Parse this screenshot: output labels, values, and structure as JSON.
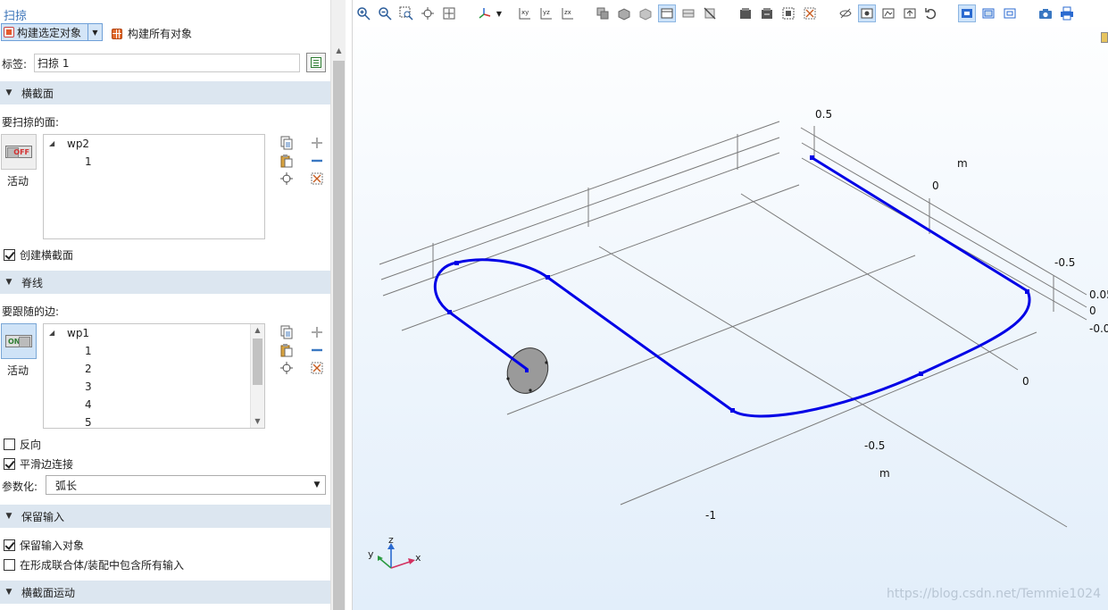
{
  "panel": {
    "title": "扫掠",
    "build_selected_label": "构建选定对象",
    "build_all_label": "构建所有对象",
    "label_field_label": "标签:",
    "label_field_value": "扫掠 1"
  },
  "cross_section": {
    "header": "横截面",
    "faces_label": "要扫掠的面:",
    "active_label": "活动",
    "toggle_state": "OFF",
    "list": [
      "wp2",
      "1"
    ],
    "create_checkbox_label": "创建横截面",
    "create_checked": true
  },
  "spine": {
    "header": "脊线",
    "edges_label": "要跟随的边:",
    "active_label": "活动",
    "toggle_state": "ON",
    "list": [
      "wp1",
      "1",
      "2",
      "3",
      "4",
      "5"
    ],
    "reverse_label": "反向",
    "reverse_checked": false,
    "smooth_label": "平滑边连接",
    "smooth_checked": true,
    "param_label": "参数化:",
    "param_value": "弧长"
  },
  "keep_input": {
    "header": "保留输入",
    "keep_objects_label": "保留输入对象",
    "keep_objects_checked": true,
    "include_all_label": "在形成联合体/装配中包含所有输入",
    "include_all_checked": false
  },
  "motion": {
    "header": "横截面运动"
  },
  "graphics": {
    "toolbar_icons": [
      "zoom-in-icon",
      "zoom-out-icon",
      "zoom-box-icon",
      "zoom-selected-icon",
      "zoom-extents-icon",
      "view-axis-icon",
      "view-dropdown-icon",
      "view-xy-icon",
      "view-yz-icon",
      "view-zx-icon",
      "scene-light-icon",
      "transparency-icon",
      "wireframe-icon",
      "render-mode-icon",
      "hide-icon",
      "select-all-icon",
      "box-select-icon",
      "clear-select-icon",
      "zoom-obj-icon",
      "reset-view-icon",
      "rotate-icon",
      "show-grid-icon",
      "show-axes-icon",
      "screenshot-icon",
      "print-icon"
    ],
    "axis_labels": {
      "top_05": "0.5",
      "unit_top": "m",
      "top_0": "0",
      "right_m05": "-0.5",
      "right_005": "0.05",
      "right_0": "0",
      "right_m00": "-0.0",
      "bottom_0": "0",
      "bottom_m05": "-0.5",
      "unit_bottom": "m",
      "bottom_m1": "-1"
    },
    "triad": {
      "z": "z",
      "y": "y",
      "x": "x"
    },
    "watermark": "https://blog.csdn.net/Temmie1024",
    "colors": {
      "path": "#0000e6",
      "grid": "#7a7a7a",
      "disk": "#9a9a9a"
    }
  }
}
